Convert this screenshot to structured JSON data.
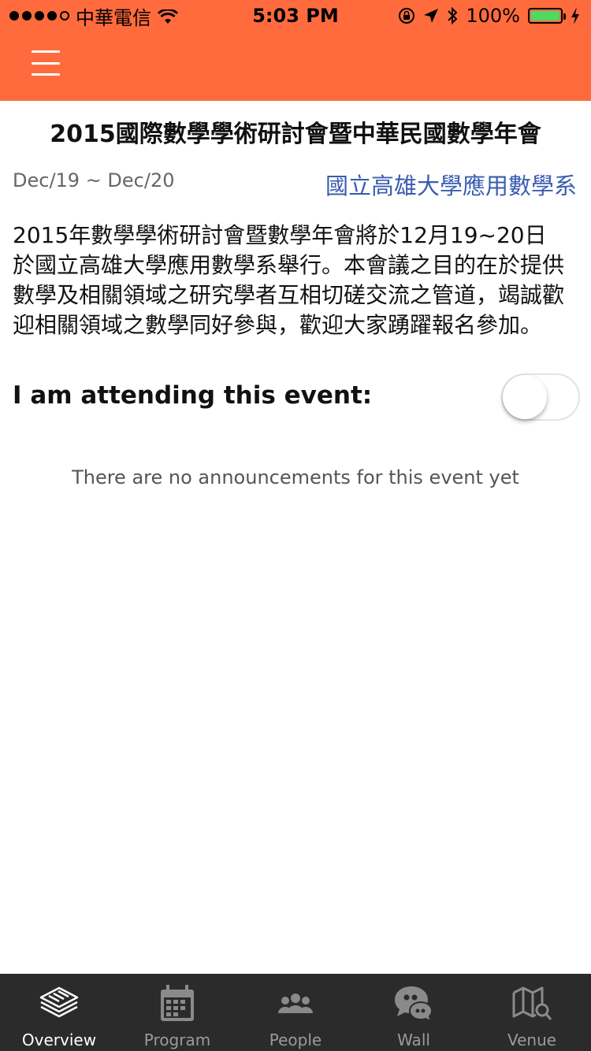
{
  "status_bar": {
    "carrier": "中華電信",
    "time": "5:03 PM",
    "battery": "100%"
  },
  "header": {
    "menu_icon": "hamburger-menu-icon",
    "color": "#ff6b3d"
  },
  "event": {
    "title": "2015國際數學學術研討會暨中華民國數學年會",
    "dates": "Dec/19 ~ Dec/20",
    "organizer": "國立高雄大學應用數學系",
    "description": "2015年數學學術研討會暨數學年會將於12月19~20日於國立高雄大學應用數學系舉行。本會議之目的在於提供數學及相關領域之研究學者互相切磋交流之管道，竭誠歡迎相關領域之數學同好參與，歡迎大家踴躍報名參加。",
    "attending_label": "I am attending this event:",
    "attending": false,
    "no_announcements": "There are no announcements for this event yet"
  },
  "tabs": [
    {
      "label": "Overview",
      "icon": "newspaper-icon",
      "active": true
    },
    {
      "label": "Program",
      "icon": "calendar-icon",
      "active": false
    },
    {
      "label": "People",
      "icon": "people-icon",
      "active": false
    },
    {
      "label": "Wall",
      "icon": "chat-bubble-icon",
      "active": false
    },
    {
      "label": "Venue",
      "icon": "map-search-icon",
      "active": false
    }
  ]
}
